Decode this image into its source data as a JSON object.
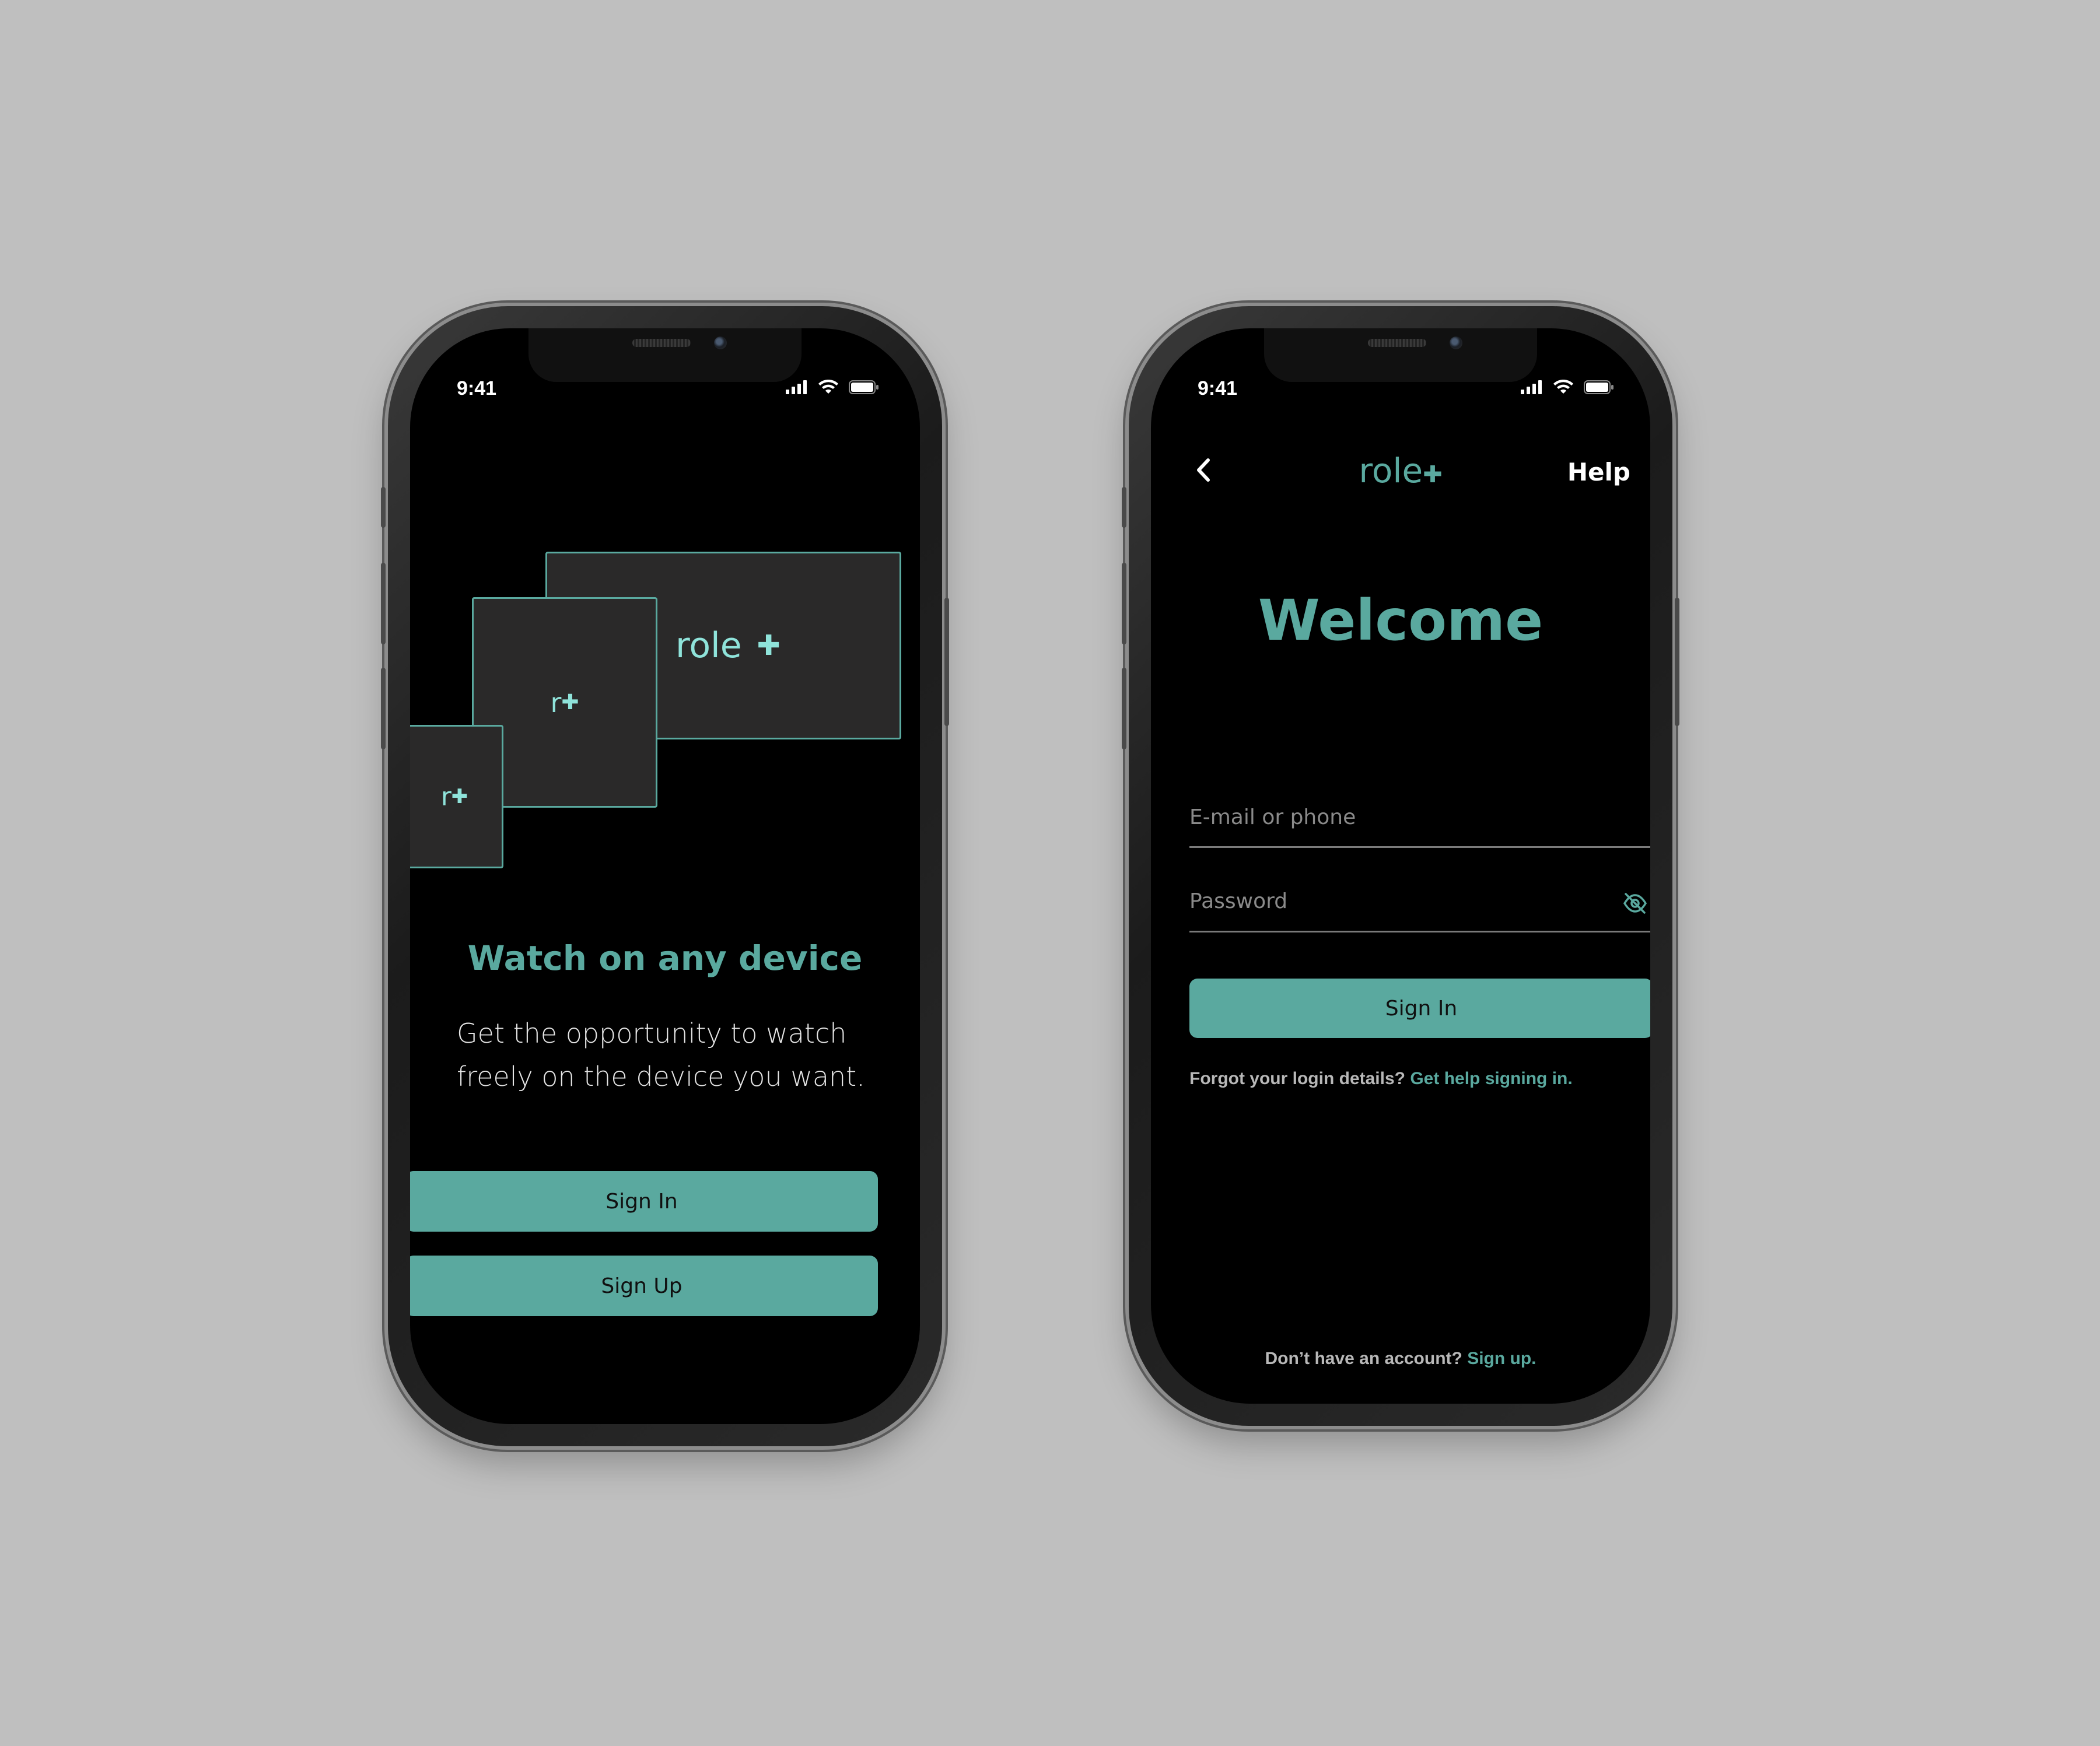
{
  "colors": {
    "background": "#bfbfbf",
    "accent": "#5aa99f",
    "screen": "#000000"
  },
  "onboarding_screen": {
    "status_bar": {
      "time": "9:41",
      "icons": [
        "signal-icon",
        "wifi-icon",
        "battery-icon"
      ]
    },
    "illustration": {
      "large_device_logo": "role",
      "medium_device_logo": "r",
      "small_device_logo": "r"
    },
    "title": "Watch on any device",
    "description": "Get the opportunity to watch freely on the device you want.",
    "sign_in_label": "Sign In",
    "sign_up_label": "Sign Up"
  },
  "login_screen": {
    "status_bar": {
      "time": "9:41",
      "icons": [
        "signal-icon",
        "wifi-icon",
        "battery-icon"
      ]
    },
    "header": {
      "back_icon": "chevron-left-icon",
      "logo_text": "role",
      "help_label": "Help"
    },
    "title": "Welcome",
    "email_field": {
      "placeholder": "E-mail or phone",
      "value": ""
    },
    "password_field": {
      "placeholder": "Password",
      "value": "",
      "toggle_icon": "eye-off-icon"
    },
    "sign_in_label": "Sign In",
    "forgot_text": "Forgot your login details?",
    "forgot_link": "Get help signing in.",
    "signup_prompt": "Don’t have an account?",
    "signup_link": "Sign up."
  }
}
